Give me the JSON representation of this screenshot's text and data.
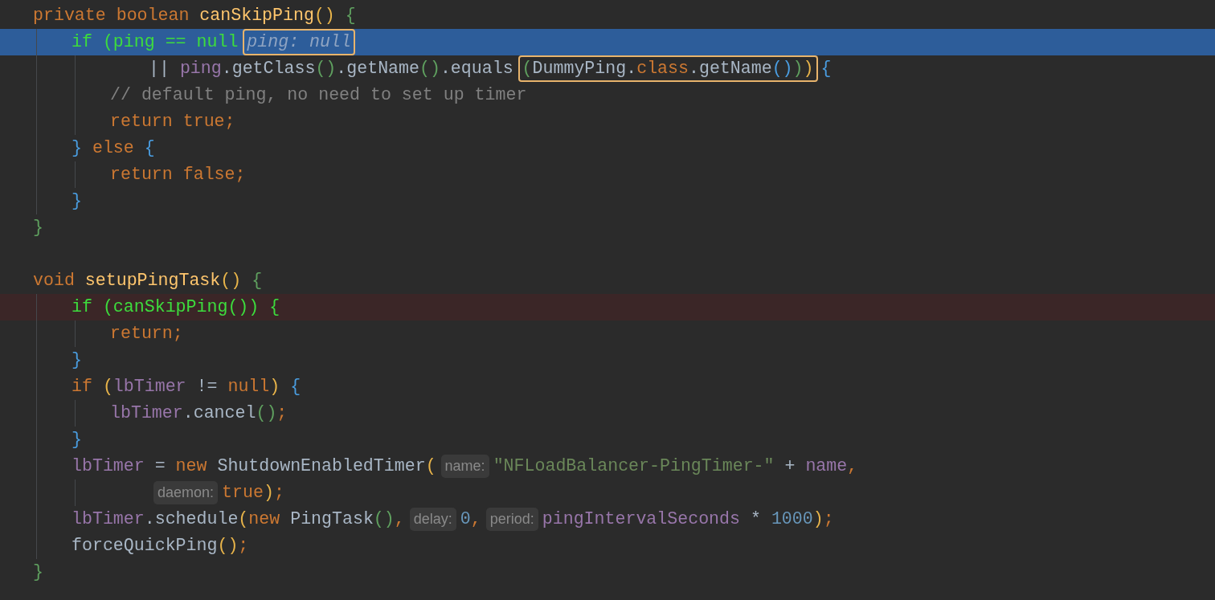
{
  "lines": [
    {
      "current": false,
      "breakpoint": false,
      "segments": [
        {
          "kind": "code",
          "framed": false,
          "tokens": [
            {
              "text": "private boolean ",
              "kind": "keyword"
            },
            {
              "text": "canSkipPing",
              "kind": "decl"
            },
            {
              "text": "() ",
              "kind": "paren-y"
            },
            {
              "text": "{",
              "kind": "brace-g"
            }
          ]
        }
      ],
      "children": [
        {
          "current": true,
          "breakpoint": false,
          "segments": [
            {
              "kind": "code",
              "framed": false,
              "tokens": [
                {
                  "text": "if (ping == null",
                  "kind": "exec"
                }
              ]
            },
            {
              "kind": "value",
              "framed": true,
              "text": "ping: null"
            }
          ],
          "continuation": [
            {
              "current": false,
              "breakpoint": false,
              "segments": [
                {
                  "kind": "code",
                  "framed": false,
                  "tokens": [
                    {
                      "text": "|| ",
                      "kind": "plain"
                    },
                    {
                      "text": "ping",
                      "kind": "field"
                    },
                    {
                      "text": ".getClass",
                      "kind": "plain"
                    },
                    {
                      "text": "()",
                      "kind": "paren-g"
                    },
                    {
                      "text": ".getName",
                      "kind": "plain"
                    },
                    {
                      "text": "()",
                      "kind": "paren-g"
                    },
                    {
                      "text": ".equals",
                      "kind": "plain"
                    }
                  ]
                },
                {
                  "kind": "code",
                  "framed": true,
                  "tokens": [
                    {
                      "text": "(",
                      "kind": "paren-g"
                    },
                    {
                      "text": "DummyPing.",
                      "kind": "plain"
                    },
                    {
                      "text": "class",
                      "kind": "keyword"
                    },
                    {
                      "text": ".getName",
                      "kind": "plain"
                    },
                    {
                      "text": "()",
                      "kind": "paren-b"
                    },
                    {
                      "text": ")",
                      "kind": "paren-g"
                    },
                    {
                      "text": ")",
                      "kind": "paren-y"
                    }
                  ]
                },
                {
                  "kind": "code",
                  "framed": false,
                  "tokens": [
                    {
                      "text": "{",
                      "kind": "brace-b"
                    }
                  ]
                }
              ]
            }
          ],
          "children": [
            {
              "current": false,
              "breakpoint": false,
              "segments": [
                {
                  "kind": "code",
                  "framed": false,
                  "tokens": [
                    {
                      "text": "// default ping, no need to set up timer",
                      "kind": "comment"
                    }
                  ]
                }
              ]
            },
            {
              "current": false,
              "breakpoint": false,
              "segments": [
                {
                  "kind": "code",
                  "framed": false,
                  "tokens": [
                    {
                      "text": "return true;",
                      "kind": "keyword"
                    }
                  ]
                }
              ]
            }
          ]
        },
        {
          "current": false,
          "breakpoint": false,
          "segments": [
            {
              "kind": "code",
              "framed": false,
              "tokens": [
                {
                  "text": "}",
                  "kind": "brace-b"
                },
                {
                  "text": " else ",
                  "kind": "keyword"
                },
                {
                  "text": "{",
                  "kind": "brace-b"
                }
              ]
            }
          ],
          "children": [
            {
              "current": false,
              "breakpoint": false,
              "segments": [
                {
                  "kind": "code",
                  "framed": false,
                  "tokens": [
                    {
                      "text": "return false;",
                      "kind": "keyword"
                    }
                  ]
                }
              ]
            }
          ]
        },
        {
          "current": false,
          "breakpoint": false,
          "segments": [
            {
              "kind": "code",
              "framed": false,
              "tokens": [
                {
                  "text": "}",
                  "kind": "brace-b"
                }
              ]
            }
          ]
        }
      ]
    },
    {
      "current": false,
      "breakpoint": false,
      "segments": [
        {
          "kind": "code",
          "framed": false,
          "tokens": [
            {
              "text": "}",
              "kind": "brace-g"
            }
          ]
        }
      ]
    },
    {
      "current": false,
      "breakpoint": false
    },
    {
      "current": false,
      "breakpoint": false,
      "segments": [
        {
          "kind": "code",
          "framed": false,
          "tokens": [
            {
              "text": "void ",
              "kind": "keyword"
            },
            {
              "text": "setupPingTask",
              "kind": "decl"
            },
            {
              "text": "() ",
              "kind": "paren-y"
            },
            {
              "text": "{",
              "kind": "brace-g"
            }
          ]
        }
      ],
      "children": [
        {
          "current": false,
          "breakpoint": true,
          "segments": [
            {
              "kind": "code",
              "framed": false,
              "tokens": [
                {
                  "text": "if (canSkipPing()) {",
                  "kind": "exec"
                }
              ]
            }
          ],
          "children": [
            {
              "current": false,
              "breakpoint": false,
              "segments": [
                {
                  "kind": "code",
                  "framed": false,
                  "tokens": [
                    {
                      "text": "return;",
                      "kind": "keyword"
                    }
                  ]
                }
              ]
            }
          ]
        },
        {
          "current": false,
          "breakpoint": false,
          "segments": [
            {
              "kind": "code",
              "framed": false,
              "tokens": [
                {
                  "text": "}",
                  "kind": "brace-b"
                }
              ]
            }
          ]
        },
        {
          "current": false,
          "breakpoint": false,
          "segments": [
            {
              "kind": "code",
              "framed": false,
              "tokens": [
                {
                  "text": "if ",
                  "kind": "keyword"
                },
                {
                  "text": "(",
                  "kind": "paren-y"
                },
                {
                  "text": "lbTimer",
                  "kind": "field"
                },
                {
                  "text": " != ",
                  "kind": "plain"
                },
                {
                  "text": "null",
                  "kind": "keyword"
                },
                {
                  "text": ") ",
                  "kind": "paren-y"
                },
                {
                  "text": "{",
                  "kind": "brace-b"
                }
              ]
            }
          ],
          "children": [
            {
              "current": false,
              "breakpoint": false,
              "segments": [
                {
                  "kind": "code",
                  "framed": false,
                  "tokens": [
                    {
                      "text": "lbTimer",
                      "kind": "field"
                    },
                    {
                      "text": ".cancel",
                      "kind": "plain"
                    },
                    {
                      "text": "()",
                      "kind": "paren-g"
                    },
                    {
                      "text": ";",
                      "kind": "keyword"
                    }
                  ]
                }
              ]
            }
          ]
        },
        {
          "current": false,
          "breakpoint": false,
          "segments": [
            {
              "kind": "code",
              "framed": false,
              "tokens": [
                {
                  "text": "}",
                  "kind": "brace-b"
                }
              ]
            }
          ]
        },
        {
          "current": false,
          "breakpoint": false,
          "segments": [
            {
              "kind": "code",
              "framed": false,
              "tokens": [
                {
                  "text": "lbTimer",
                  "kind": "field"
                },
                {
                  "text": " = ",
                  "kind": "plain"
                },
                {
                  "text": "new ",
                  "kind": "keyword"
                },
                {
                  "text": "ShutdownEnabledTimer",
                  "kind": "plain"
                },
                {
                  "text": "(",
                  "kind": "paren-y"
                }
              ]
            },
            {
              "kind": "hint",
              "text": "name:"
            },
            {
              "kind": "code",
              "framed": false,
              "tokens": [
                {
                  "text": "\"NFLoadBalancer-PingTimer-\"",
                  "kind": "string"
                },
                {
                  "text": " + ",
                  "kind": "plain"
                },
                {
                  "text": "name",
                  "kind": "field"
                },
                {
                  "text": ",",
                  "kind": "keyword"
                }
              ]
            }
          ],
          "continuation": [
            {
              "current": false,
              "breakpoint": false,
              "segments": [
                {
                  "kind": "hint",
                  "text": "daemon:"
                },
                {
                  "kind": "code",
                  "framed": false,
                  "tokens": [
                    {
                      "text": "true",
                      "kind": "keyword"
                    },
                    {
                      "text": ")",
                      "kind": "paren-y"
                    },
                    {
                      "text": ";",
                      "kind": "keyword"
                    }
                  ]
                }
              ]
            }
          ]
        },
        {
          "current": false,
          "breakpoint": false,
          "segments": [
            {
              "kind": "code",
              "framed": false,
              "tokens": [
                {
                  "text": "lbTimer",
                  "kind": "field"
                },
                {
                  "text": ".schedule",
                  "kind": "plain"
                },
                {
                  "text": "(",
                  "kind": "paren-y"
                },
                {
                  "text": "new ",
                  "kind": "keyword"
                },
                {
                  "text": "PingTask",
                  "kind": "plain"
                },
                {
                  "text": "()",
                  "kind": "paren-g"
                },
                {
                  "text": ",",
                  "kind": "keyword"
                }
              ]
            },
            {
              "kind": "hint",
              "text": "delay:"
            },
            {
              "kind": "code",
              "framed": false,
              "tokens": [
                {
                  "text": "0",
                  "kind": "number"
                },
                {
                  "text": ",",
                  "kind": "keyword"
                }
              ]
            },
            {
              "kind": "hint",
              "text": "period:"
            },
            {
              "kind": "code",
              "framed": false,
              "tokens": [
                {
                  "text": "pingIntervalSeconds",
                  "kind": "field"
                },
                {
                  "text": " * ",
                  "kind": "plain"
                },
                {
                  "text": "1000",
                  "kind": "number"
                },
                {
                  "text": ")",
                  "kind": "paren-y"
                },
                {
                  "text": ";",
                  "kind": "keyword"
                }
              ]
            }
          ]
        },
        {
          "current": false,
          "breakpoint": false,
          "segments": [
            {
              "kind": "code",
              "framed": false,
              "tokens": [
                {
                  "text": "forceQuickPing",
                  "kind": "plain"
                },
                {
                  "text": "()",
                  "kind": "paren-y"
                },
                {
                  "text": ";",
                  "kind": "keyword"
                }
              ]
            }
          ]
        }
      ]
    },
    {
      "current": false,
      "breakpoint": false,
      "segments": [
        {
          "kind": "code",
          "framed": false,
          "tokens": [
            {
              "text": "}",
              "kind": "brace-g"
            }
          ]
        }
      ]
    }
  ]
}
